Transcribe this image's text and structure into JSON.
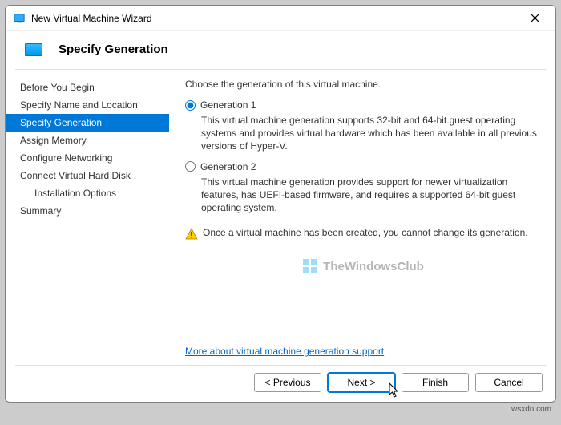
{
  "window": {
    "title": "New Virtual Machine Wizard"
  },
  "header": {
    "heading": "Specify Generation"
  },
  "sidebar": {
    "items": [
      {
        "label": "Before You Begin"
      },
      {
        "label": "Specify Name and Location"
      },
      {
        "label": "Specify Generation"
      },
      {
        "label": "Assign Memory"
      },
      {
        "label": "Configure Networking"
      },
      {
        "label": "Connect Virtual Hard Disk"
      },
      {
        "label": "Installation Options"
      },
      {
        "label": "Summary"
      }
    ]
  },
  "content": {
    "prompt": "Choose the generation of this virtual machine.",
    "options": [
      {
        "label": "Generation 1",
        "description": "This virtual machine generation supports 32-bit and 64-bit guest operating systems and provides virtual hardware which has been available in all previous versions of Hyper-V."
      },
      {
        "label": "Generation 2",
        "description": "This virtual machine generation provides support for newer virtualization features, has UEFI-based firmware, and requires a supported 64-bit guest operating system."
      }
    ],
    "warning": "Once a virtual machine has been created, you cannot change its generation.",
    "link": "More about virtual machine generation support",
    "watermark": "TheWindowsClub"
  },
  "footer": {
    "previous": "< Previous",
    "next": "Next >",
    "finish": "Finish",
    "cancel": "Cancel"
  },
  "site_watermark": "wsxdn.com"
}
